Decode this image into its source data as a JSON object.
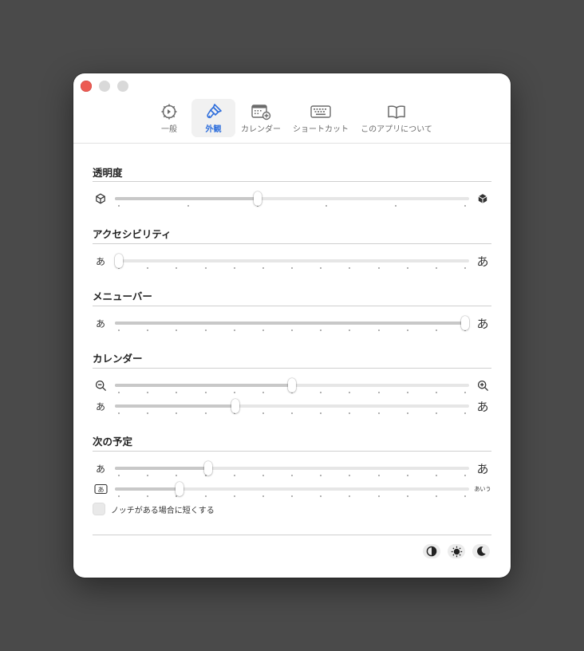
{
  "window": {
    "controls": [
      "close",
      "minimize",
      "zoom"
    ]
  },
  "toolbar": {
    "tabs": [
      {
        "label": "一般",
        "icon": "gear-icon",
        "active": false
      },
      {
        "label": "外観",
        "icon": "paintbrush-icon",
        "active": true
      },
      {
        "label": "カレンダー",
        "icon": "calendar-add-icon",
        "active": false
      },
      {
        "label": "ショートカット",
        "icon": "keyboard-icon",
        "active": false
      },
      {
        "label": "このアプリについて",
        "icon": "book-icon",
        "active": false
      }
    ]
  },
  "sections": {
    "transparency": {
      "title": "透明度",
      "slider": {
        "value": 0.4,
        "ticks": 6,
        "left_icon": "cube-outline-icon",
        "right_icon": "cube-filled-icon"
      }
    },
    "accessibility": {
      "title": "アクセシビリティ",
      "slider": {
        "value": 0.0,
        "ticks": 13,
        "left_label": "あ",
        "right_label": "あ"
      }
    },
    "menubar": {
      "title": "メニューバー",
      "slider": {
        "value": 1.0,
        "ticks": 13,
        "left_label": "あ",
        "right_label": "あ"
      }
    },
    "calendar": {
      "title": "カレンダー",
      "zoom_slider": {
        "value": 0.5,
        "ticks": 13,
        "left_icon": "zoom-out-icon",
        "right_icon": "zoom-in-icon"
      },
      "font_slider": {
        "value": 0.337,
        "ticks": 13,
        "left_label": "あ",
        "right_label": "あ"
      }
    },
    "next_event": {
      "title": "次の予定",
      "font_slider": {
        "value": 0.258,
        "ticks": 13,
        "left_label": "あ",
        "right_label": "あ"
      },
      "length_slider": {
        "value": 0.174,
        "ticks": 13,
        "left_icon": "text-box-icon",
        "left_icon_text": "あ",
        "right_label": "あいう"
      },
      "checkbox": {
        "label": "ノッチがある場合に短くする",
        "checked": false
      }
    }
  },
  "footer": {
    "theme_buttons": [
      "contrast-icon",
      "sun-icon",
      "moon-icon"
    ]
  }
}
